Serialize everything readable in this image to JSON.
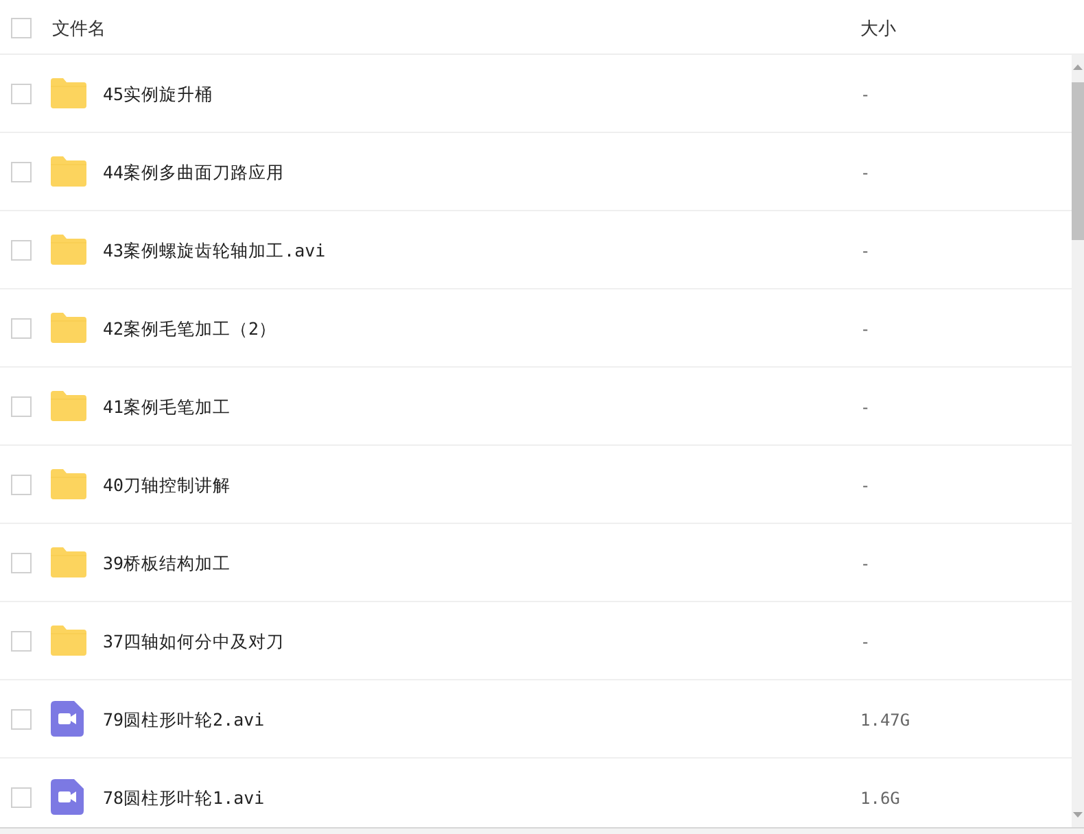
{
  "header": {
    "select_all": {
      "checked": false
    },
    "columns": [
      "文件名",
      "大小"
    ]
  },
  "files": [
    {
      "kind": "folder",
      "name": "45实例旋升桶",
      "size": "-",
      "checked": false
    },
    {
      "kind": "folder",
      "name": "44案例多曲面刀路应用",
      "size": "-",
      "checked": false
    },
    {
      "kind": "folder",
      "name": "43案例螺旋齿轮轴加工.avi",
      "size": "-",
      "checked": false
    },
    {
      "kind": "folder",
      "name": "42案例毛笔加工（2）",
      "size": "-",
      "checked": false
    },
    {
      "kind": "folder",
      "name": "41案例毛笔加工",
      "size": "-",
      "checked": false
    },
    {
      "kind": "folder",
      "name": "40刀轴控制讲解",
      "size": "-",
      "checked": false
    },
    {
      "kind": "folder",
      "name": "39桥板结构加工",
      "size": "-",
      "checked": false
    },
    {
      "kind": "folder",
      "name": "37四轴如何分中及对刀",
      "size": "-",
      "checked": false
    },
    {
      "kind": "video",
      "name": "79圆柱形叶轮2.avi",
      "size": "1.47G",
      "checked": false
    },
    {
      "kind": "video",
      "name": "78圆柱形叶轮1.avi",
      "size": "1.6G",
      "checked": false
    }
  ]
}
